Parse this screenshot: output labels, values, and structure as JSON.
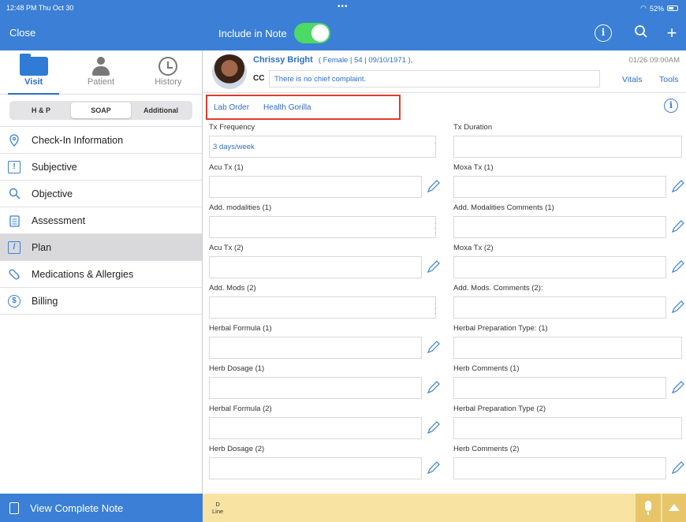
{
  "status": {
    "time": "12:48 PM  Thu Oct 30",
    "battery": "52%"
  },
  "topbar": {
    "close_label": "Close",
    "include_label": "Include in Note",
    "include_on": true
  },
  "sidebar": {
    "modes": [
      {
        "label": "Visit",
        "icon": "folder-icon"
      },
      {
        "label": "Patient",
        "icon": "person-icon"
      },
      {
        "label": "History",
        "icon": "history-icon"
      }
    ],
    "segments": [
      "H & P",
      "SOAP",
      "Additional"
    ],
    "active_segment": "SOAP",
    "items": [
      {
        "label": "Check-In Information",
        "icon": "location-pin-icon"
      },
      {
        "label": "Subjective",
        "icon": "alert-box-icon"
      },
      {
        "label": "Objective",
        "icon": "search-icon"
      },
      {
        "label": "Assessment",
        "icon": "clipboard-icon"
      },
      {
        "label": "Plan",
        "icon": "edit-box-icon"
      },
      {
        "label": "Medications & Allergies",
        "icon": "pill-icon"
      },
      {
        "label": "Billing",
        "icon": "dollar-icon"
      }
    ],
    "active_item": "Plan",
    "view_note_label": "View Complete Note"
  },
  "patient": {
    "name": "Chrissy Bright",
    "info": "( Female | 54 | 09/10/1971 ),",
    "cc_label": "CC",
    "cc_value": "There is no chief complaint.",
    "date": "01/26 09:00AM",
    "vitals": "Vitals",
    "tools": "Tools"
  },
  "links": {
    "lab_order": "Lab Order",
    "health_gorilla": "Health Gorilla"
  },
  "fields": {
    "tx_frequency": {
      "label": "Tx Frequency",
      "value": "3 days/week"
    },
    "tx_duration": {
      "label": "Tx Duration",
      "value": ""
    },
    "acu_tx_1": {
      "label": "Acu Tx (1)",
      "value": ""
    },
    "moxa_tx_1": {
      "label": "Moxa Tx (1)",
      "value": ""
    },
    "add_mod_1": {
      "label": "Add. modalities (1)",
      "value": ""
    },
    "add_mod_comm_1": {
      "label": "Add. Modalities Comments (1)",
      "value": ""
    },
    "acu_tx_2": {
      "label": "Acu Tx (2)",
      "value": ""
    },
    "moxa_tx_2": {
      "label": "Moxa Tx (2)",
      "value": ""
    },
    "add_mods_2": {
      "label": "Add. Mods (2)",
      "value": ""
    },
    "add_mods_comm_2": {
      "label": "Add. Mods. Comments (2):",
      "value": ""
    },
    "herbal_formula_1": {
      "label": "Herbal Formula (1)",
      "value": ""
    },
    "herbal_prep_1": {
      "label": "Herbal Preparation Type: (1)",
      "value": ""
    },
    "herb_dosage_1": {
      "label": "Herb Dosage (1)",
      "value": ""
    },
    "herb_comm_1": {
      "label": "Herb Comments (1)",
      "value": ""
    },
    "herbal_formula_2": {
      "label": "Herbal Formula (2)",
      "value": ""
    },
    "herbal_prep_2": {
      "label": "Herbal Preparation Type (2)",
      "value": ""
    },
    "herb_dosage_2": {
      "label": "Herb Dosage (2)",
      "value": ""
    },
    "herb_comm_2": {
      "label": "Herb Comments (2)",
      "value": ""
    }
  },
  "bottom": {
    "d_label": "D",
    "line_label": "Line"
  }
}
